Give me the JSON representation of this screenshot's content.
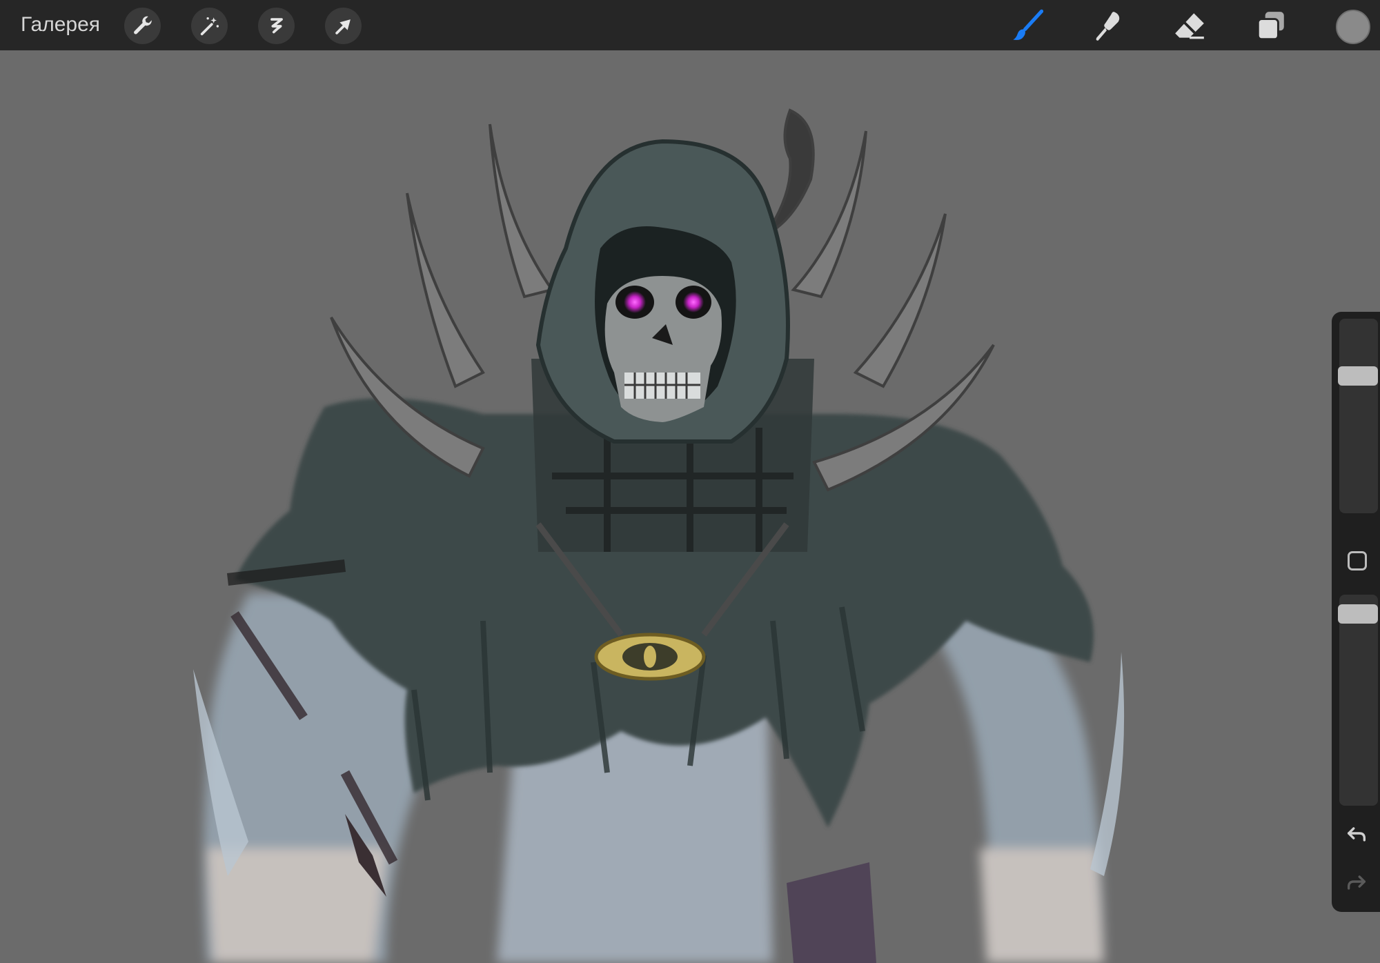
{
  "toolbar": {
    "gallery_label": "Галерея",
    "left_tools": [
      {
        "name": "wrench-icon"
      },
      {
        "name": "magic-wand-icon"
      },
      {
        "name": "selection-icon"
      },
      {
        "name": "transform-arrow-icon"
      }
    ],
    "right_tools": [
      {
        "name": "brush-icon",
        "active_color": "#1a7cf5"
      },
      {
        "name": "smudge-icon"
      },
      {
        "name": "eraser-icon"
      },
      {
        "name": "layers-icon"
      }
    ],
    "current_color": "#8a8a8a"
  },
  "sidebar": {
    "brush_size_level": 0.73,
    "opacity_level": 0.95,
    "icons": [
      "modify-square-icon",
      "undo-icon",
      "redo-icon"
    ]
  },
  "canvas": {
    "background": "#6b6b6b",
    "artwork": "hooded-skeleton-reaper-sketch"
  }
}
